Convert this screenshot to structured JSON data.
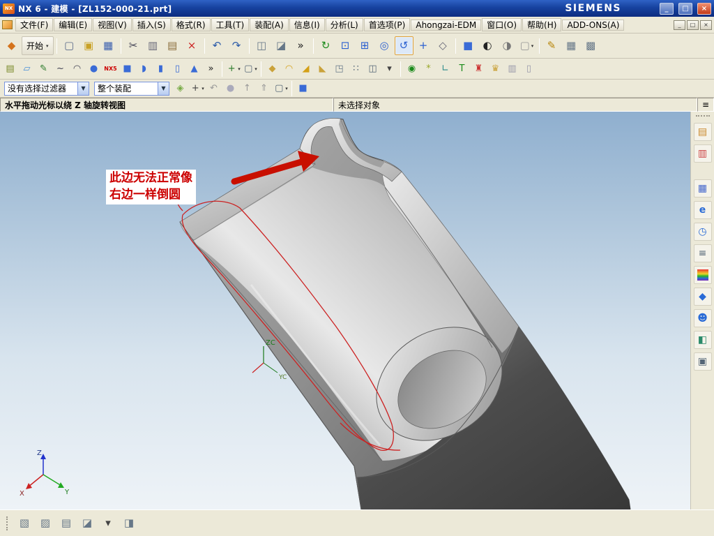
{
  "colors": {
    "titlebar_blue": "#17429f",
    "annotation_red": "#cc0000",
    "viewport_top": "#8fafcf",
    "viewport_bottom": "#eef3f7",
    "accent_blue": "#3a6bd6",
    "model_dark": "#3f3f3f",
    "model_light": "#e8e8e8"
  },
  "window": {
    "title": "NX 6 - 建模 - [ZL152-000-21.prt]",
    "brand": "SIEMENS",
    "controls": {
      "minimize": "_",
      "maximize": "□",
      "close": "×"
    }
  },
  "menubar": {
    "items": [
      {
        "name": "menu-file",
        "label": "文件(F)"
      },
      {
        "name": "menu-edit",
        "label": "编辑(E)"
      },
      {
        "name": "menu-view",
        "label": "视图(V)"
      },
      {
        "name": "menu-insert",
        "label": "插入(S)"
      },
      {
        "name": "menu-format",
        "label": "格式(R)"
      },
      {
        "name": "menu-tools",
        "label": "工具(T)"
      },
      {
        "name": "menu-assemblies",
        "label": "装配(A)"
      },
      {
        "name": "menu-information",
        "label": "信息(I)"
      },
      {
        "name": "menu-analysis",
        "label": "分析(L)"
      },
      {
        "name": "menu-preferences",
        "label": "首选项(P)"
      },
      {
        "name": "menu-ahongzai-edm",
        "label": "Ahongzai-EDM"
      },
      {
        "name": "menu-window",
        "label": "窗口(O)"
      },
      {
        "name": "menu-help",
        "label": "帮助(H)"
      },
      {
        "name": "menu-addons",
        "label": "ADD-ONS(A)"
      }
    ],
    "controls": {
      "minimize": "_",
      "restore": "□",
      "close": "×"
    }
  },
  "toolbars": {
    "row1": [
      {
        "name": "start-icon",
        "glyph": "◆",
        "fg": "#d4731c"
      },
      {
        "name": "start-button",
        "label": "开始",
        "caret": true
      },
      {
        "sep": true
      },
      {
        "name": "new-button",
        "glyph": "▢",
        "fg": "#5a6a8a"
      },
      {
        "name": "open-button",
        "glyph": "▣",
        "fg": "#c9a227"
      },
      {
        "name": "save-button",
        "glyph": "▦",
        "fg": "#3a5fae"
      },
      {
        "sep": true
      },
      {
        "name": "cut-button",
        "glyph": "✂",
        "fg": "#444455"
      },
      {
        "name": "copy-button",
        "glyph": "▥",
        "fg": "#666677"
      },
      {
        "name": "paste-button",
        "glyph": "▤",
        "fg": "#8a6d3b"
      },
      {
        "name": "delete-button",
        "glyph": "×",
        "fg": "#cc2222"
      },
      {
        "sep": true
      },
      {
        "name": "undo-button",
        "glyph": "↶",
        "fg": "#2a5aa8"
      },
      {
        "name": "redo-button",
        "glyph": "↷",
        "fg": "#2a5aa8"
      },
      {
        "sep": true
      },
      {
        "name": "copy-display-button",
        "glyph": "◫",
        "fg": "#667788"
      },
      {
        "name": "paste-display-button",
        "glyph": "◪",
        "fg": "#667788"
      },
      {
        "name": "row1-overflow-button",
        "glyph": "»",
        "fg": "#222222"
      },
      {
        "sep": true
      },
      {
        "name": "regenerate-button",
        "glyph": "↻",
        "fg": "#1a8a1a"
      },
      {
        "name": "fit-view-button",
        "glyph": "⊡",
        "fg": "#2a5fd0"
      },
      {
        "name": "zoom-window-button",
        "glyph": "⊞",
        "fg": "#2a5fd0"
      },
      {
        "name": "zoom-button",
        "glyph": "◎",
        "fg": "#2a5fd0"
      },
      {
        "name": "rotate-button",
        "glyph": "↺",
        "fg": "#2a5fd0",
        "active": true
      },
      {
        "name": "pan-button",
        "glyph": "+",
        "fg": "#2a5fd0"
      },
      {
        "name": "snap-view-button",
        "glyph": "◇",
        "fg": "#666677"
      },
      {
        "sep": true
      },
      {
        "name": "shaded-button",
        "glyph": "■",
        "fg": "#3a6bd6"
      },
      {
        "name": "display-mode-button",
        "glyph": "◐",
        "fg": "#222222"
      },
      {
        "name": "face-analysis-button",
        "glyph": "◑",
        "fg": "#777777"
      },
      {
        "name": "background-button",
        "glyph": "▢",
        "fg": "#999999",
        "caret": true
      },
      {
        "sep": true
      },
      {
        "name": "drafting-button",
        "glyph": "✎",
        "fg": "#b8860b"
      },
      {
        "name": "sheet-button",
        "glyph": "▦",
        "fg": "#667788"
      },
      {
        "name": "customize-button",
        "glyph": "▩",
        "fg": "#667788"
      }
    ],
    "row2": [
      {
        "name": "constraints-button",
        "glyph": "▤",
        "fg": "#7a8a2a"
      },
      {
        "name": "datum-plane-button",
        "glyph": "▱",
        "fg": "#4a90d9"
      },
      {
        "name": "sketch-button",
        "glyph": "✎",
        "fg": "#2a7a2a"
      },
      {
        "name": "curve-button",
        "glyph": "~",
        "fg": "#444455"
      },
      {
        "name": "arc-button",
        "glyph": "◠",
        "fg": "#444455"
      },
      {
        "name": "cylinder-button",
        "glyph": "●",
        "fg": "#3a6bd6"
      },
      {
        "name": "nx5-compat-button",
        "glyph": "NX5",
        "fg": "#cc0000",
        "text": true
      },
      {
        "name": "extrude-button",
        "glyph": "■",
        "fg": "#3a6bd6"
      },
      {
        "name": "revolve-button",
        "glyph": "◗",
        "fg": "#3a6bd6"
      },
      {
        "name": "block-button",
        "glyph": "▮",
        "fg": "#3a6bd6"
      },
      {
        "name": "tube-button",
        "glyph": "▯",
        "fg": "#3a6bd6"
      },
      {
        "name": "cone-button",
        "glyph": "▲",
        "fg": "#3a6bd6"
      },
      {
        "name": "row2-overflow-button",
        "glyph": "»",
        "fg": "#222222"
      },
      {
        "sep": true
      },
      {
        "name": "point-button",
        "glyph": "+",
        "fg": "#2a7a2a",
        "caret": true
      },
      {
        "name": "rectangle-button",
        "glyph": "▢",
        "fg": "#556677",
        "caret": true
      },
      {
        "sep": true
      },
      {
        "name": "boss-button",
        "glyph": "◆",
        "fg": "#caa23a"
      },
      {
        "name": "edge-blend-button",
        "glyph": "◠",
        "fg": "#d4a017"
      },
      {
        "name": "chamfer-button",
        "glyph": "◢",
        "fg": "#d4a017"
      },
      {
        "name": "draft-button",
        "glyph": "◣",
        "fg": "#caa23a"
      },
      {
        "name": "shell-button",
        "glyph": "◳",
        "fg": "#667788"
      },
      {
        "name": "pattern-button",
        "glyph": "∷",
        "fg": "#556677"
      },
      {
        "name": "mirror-button",
        "glyph": "◫",
        "fg": "#556677"
      },
      {
        "name": "row2-caret-button",
        "glyph": "▾",
        "fg": "#444444"
      },
      {
        "sep": true
      },
      {
        "name": "mold-check-button",
        "glyph": "◉",
        "fg": "#1a8a1a"
      },
      {
        "name": "tool-spark-button",
        "glyph": "*",
        "fg": "#9aa82a"
      },
      {
        "name": "measure-button",
        "glyph": "∟",
        "fg": "#2a8a8a"
      },
      {
        "name": "text-button",
        "glyph": "T",
        "fg": "#1a8a1a"
      },
      {
        "name": "wave-link-button",
        "glyph": "♜",
        "fg": "#cc3333"
      },
      {
        "name": "crown-tool-button",
        "glyph": "♛",
        "fg": "#caa23a"
      },
      {
        "name": "columns-button",
        "glyph": "▥",
        "fg": "#9999aa"
      },
      {
        "name": "bin-button",
        "glyph": "▯",
        "fg": "#9999aa"
      }
    ],
    "row3": {
      "filter_label": "没有选择过滤器",
      "scope_label": "整个装配",
      "icons": [
        {
          "name": "scope-filter-button",
          "glyph": "◈",
          "fg": "#77aa44"
        },
        {
          "name": "add-filter-button",
          "glyph": "+",
          "fg": "#444444",
          "caret": true
        },
        {
          "name": "general-undo-button",
          "glyph": "↶",
          "fg": "#999999"
        },
        {
          "name": "snap-ball-button",
          "glyph": "●",
          "fg": "#aaaabb"
        },
        {
          "name": "move-up-button",
          "glyph": "↑",
          "fg": "#999999"
        },
        {
          "name": "move-top-button",
          "glyph": "⇑",
          "fg": "#999999"
        },
        {
          "name": "marquee-button",
          "glyph": "▢",
          "fg": "#556677",
          "caret": true
        },
        {
          "sep": true
        },
        {
          "name": "shaded-toggle-button",
          "glyph": "■",
          "fg": "#3a6bd6"
        }
      ]
    }
  },
  "statusbar": {
    "prompt": "水平拖动光标以绕 Z 轴旋转视图",
    "selection": "未选择对象",
    "panel_glyph": "≡"
  },
  "viewport": {
    "annotation": {
      "line1": "此边无法正常像",
      "line2": "右边一样倒圆"
    },
    "csys_labels": {
      "zc": "ZC",
      "yc": "YC"
    },
    "wcs_labels": {
      "x": "X",
      "y": "Y",
      "z": "Z"
    }
  },
  "sidebar": {
    "items": [
      {
        "name": "sidebar-grip",
        "glyph": "⋮",
        "fg": "#888888",
        "grip": true
      },
      {
        "name": "assembly-navigator-button",
        "glyph": "▤",
        "fg": "#c9882a"
      },
      {
        "name": "constraint-navigator-button",
        "glyph": "▥",
        "fg": "#cc4444"
      },
      {
        "gap": true
      },
      {
        "name": "part-navigator-button",
        "glyph": "▦",
        "fg": "#4466cc"
      },
      {
        "name": "internet-explorer-button",
        "glyph": "e",
        "fg": "#2a6bd6",
        "text": true
      },
      {
        "name": "history-button",
        "glyph": "◷",
        "fg": "#2a6bd6"
      },
      {
        "name": "information-button",
        "glyph": "≡",
        "fg": "#556677"
      },
      {
        "name": "palette-button",
        "glyph": " ",
        "bg": "linear-gradient(180deg,#ee3333,#ee8a2a,#eed22a,#2ab52a,#2a6bd6,#7a2ab5)"
      },
      {
        "name": "materials-button",
        "glyph": "◆",
        "fg": "#2a6bd6"
      },
      {
        "name": "roles-button",
        "glyph": "☻",
        "fg": "#2a6bd6"
      },
      {
        "name": "web-browser-button",
        "glyph": "◧",
        "fg": "#2a8a6a"
      },
      {
        "name": "monitor-button",
        "glyph": "▣",
        "fg": "#556677"
      }
    ]
  },
  "bottombar": {
    "items": [
      {
        "name": "bottombar-grip",
        "glyph": "⋮",
        "fg": "#888888",
        "grip": true
      },
      {
        "name": "orient-view-button",
        "glyph": "▧",
        "fg": "#667788"
      },
      {
        "name": "snapshot-button",
        "glyph": "▨",
        "fg": "#667788"
      },
      {
        "name": "new-layout-button",
        "glyph": "▤",
        "fg": "#667788"
      },
      {
        "name": "export-view-button",
        "glyph": "◪",
        "fg": "#667788"
      },
      {
        "name": "bottom-caret-button",
        "glyph": "▾",
        "fg": "#444444"
      },
      {
        "name": "extra-tool-button",
        "glyph": "◨",
        "fg": "#667788"
      }
    ]
  }
}
